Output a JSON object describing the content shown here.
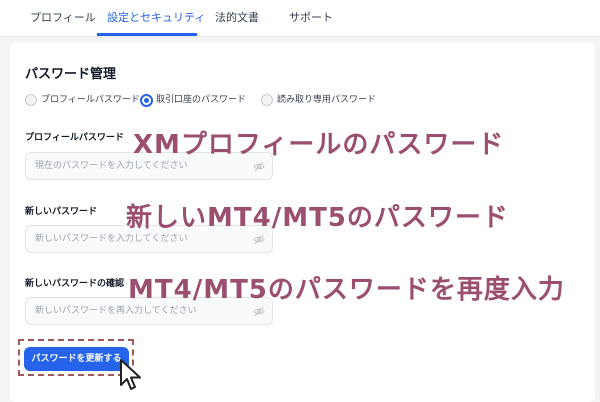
{
  "tabs": [
    {
      "label": "プロフィール"
    },
    {
      "label": "設定とセキュリティ",
      "active": true
    },
    {
      "label": "法的文書"
    },
    {
      "label": "サポート"
    }
  ],
  "section_title": "パスワード管理",
  "radio_options": [
    {
      "label": "プロフィールパスワード",
      "selected": false
    },
    {
      "label": "取引口座のパスワード",
      "selected": true
    },
    {
      "label": "読み取り専用パスワード",
      "selected": false
    }
  ],
  "fields": [
    {
      "label": "プロフィールパスワード",
      "placeholder": "現在のパスワードを入力してください"
    },
    {
      "label": "新しいパスワード",
      "placeholder": "新しいパスワードを入力してください"
    },
    {
      "label": "新しいパスワードの確認",
      "placeholder": "新しいパスワードを再入力してください"
    }
  ],
  "overlays": [
    "XMプロフィールのパスワード",
    "新しいMT4/MT5のパスワード",
    "MT4/MT5のパスワードを再度入力"
  ],
  "submit_label": "パスワードを更新する",
  "colors": {
    "accent": "#2563eb",
    "overlay_text": "#9b4f6e",
    "highlight_frame": "#a05858"
  }
}
